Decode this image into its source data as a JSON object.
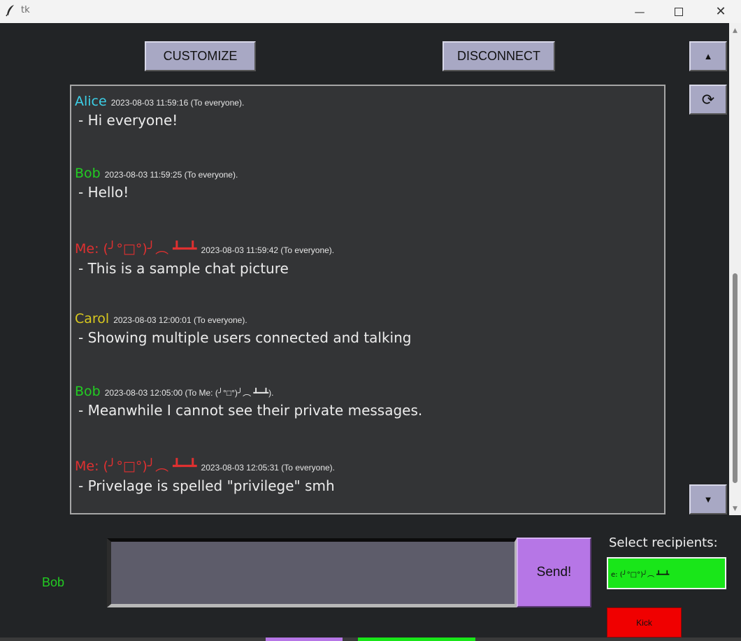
{
  "window": {
    "title": "tk"
  },
  "toolbar": {
    "customize_label": "CUSTOMIZE",
    "disconnect_label": "DISCONNECT",
    "scroll_up_glyph": "▲",
    "refresh_glyph": "⟳",
    "scroll_down_glyph": "▼"
  },
  "messages": [
    {
      "name": "Alice",
      "meta": "2023-08-03 11:59:16 (To everyone).",
      "text": " - Hi everyone!",
      "color": "#3cd0e8"
    },
    {
      "name": "Bob",
      "meta": "2023-08-03 11:59:25 (To everyone).",
      "text": " - Hello!",
      "color": "#22cc22"
    },
    {
      "name": "Me: (╯°□°)╯︵ ┻━┻",
      "meta": "2023-08-03 11:59:42 (To everyone).",
      "text": " - This is a sample chat picture",
      "color": "#e03030"
    },
    {
      "name": "Carol",
      "meta": "2023-08-03 12:00:01 (To everyone).",
      "text": " - Showing multiple users connected and talking",
      "color": "#d8c81e"
    },
    {
      "name": "Bob",
      "meta": "2023-08-03 12:05:00 (To Me: (╯°□°)╯︵ ┻━┻).",
      "text": " - Meanwhile I cannot see their private messages.",
      "color": "#22cc22"
    },
    {
      "name": "Me: (╯°□°)╯︵ ┻━┻",
      "meta": "2023-08-03 12:05:31 (To everyone).",
      "text": " - Privelage is spelled \"privilege\" smh",
      "color": "#e03030"
    }
  ],
  "composer": {
    "username": "Bob",
    "input_value": "",
    "send_label": "Send!"
  },
  "recipients": {
    "label": "Select recipients:",
    "items": [
      "e: (╯°□°)╯︵ ┻━┻"
    ],
    "kick_label": "Kick"
  },
  "colors": {
    "background": "#222426",
    "chat_bg": "#333436",
    "button": "#a8a8c4",
    "send": "#b676e6",
    "recipient_selected": "#19e619",
    "kick": "#f00000"
  }
}
